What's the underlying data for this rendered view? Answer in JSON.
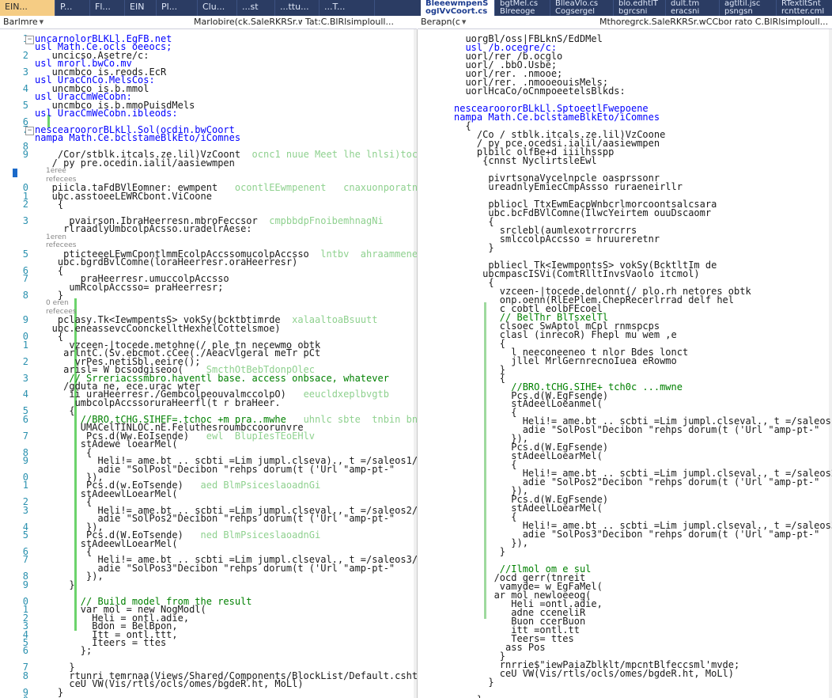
{
  "tabs_left": [
    {
      "label": "EIN...",
      "active": true
    },
    {
      "label": "P..."
    },
    {
      "label": "Fl..."
    },
    {
      "label": "EIN"
    },
    {
      "label": "Pl..."
    },
    {
      "label": "Clu..."
    },
    {
      "label": "...st"
    },
    {
      "label": "...ttu..."
    },
    {
      "label": "...T..."
    }
  ],
  "tabs_right": [
    {
      "label": "BleeewmpenS",
      "close": "×",
      "active": true
    },
    {
      "label": "bgtMel.cs"
    },
    {
      "label": "BlleaVlo.cs"
    },
    {
      "label": "blo.edhtlT"
    },
    {
      "label": "dult.tm"
    },
    {
      "label": "agtltil.jsc"
    },
    {
      "label": "RTextltSnt"
    }
  ],
  "tabs_right_sub": [
    {
      "label": "oglVvCoort.cs"
    },
    {
      "label": "Blreeoge"
    },
    {
      "label": "Cogsergel"
    },
    {
      "label": "bgrcsni"
    },
    {
      "label": "eracsni"
    },
    {
      "label": "psngsn"
    },
    {
      "label": "rcntter.cml"
    }
  ],
  "nav_left": {
    "project": "Barlmre",
    "type": "Marlobire(ck.SaleRKRSr.wCCborts.grBBLwC",
    "member": "Tat:C.BlRlsimploull..."
  },
  "nav_right": {
    "project": "Berapn(c",
    "type": "Mthoregrck.SaleRKRSr.wCCborts.bFrBLEwC",
    "member": "rato C.BlRlsimploull..."
  },
  "left_pane": {
    "lines": [
      {
        "n": "1",
        "t": "uncarnolorBLKLl.EgFB.net",
        "fold": "-"
      },
      {
        "n": "",
        "t": "usl Math.Ce.ocls oeeocs;"
      },
      {
        "n": "2",
        "t": "   uncicso.Asetre/c:"
      },
      {
        "n": "",
        "t": "usl mrorl.bwCo.mv"
      },
      {
        "n": "3",
        "t": "   uncmbco is.reods.EcR"
      },
      {
        "n": "",
        "t": "usl UracCnCo.MelsCos:"
      },
      {
        "n": "4",
        "t": "   uncmbco is.b.mmol"
      },
      {
        "n": "",
        "t": "usl UracCmWeCobn:"
      },
      {
        "n": "5",
        "t": "   uncmbco is.b.mmoPuisdMels"
      },
      {
        "n": "",
        "t": "usl UracCmWeCobn.ibleods:"
      },
      {
        "n": "6",
        "t": ""
      },
      {
        "n": "7",
        "t": "nescearoororBLkLl.Sol(ocdin.bwCoort",
        "fold": "-"
      },
      {
        "n": "",
        "t": "nampa Math.Ce.bclstameBlkEto/iComnes"
      },
      {
        "n": "8",
        "t": ""
      },
      {
        "n": "9",
        "t": "    /Cor/stblk.itcals.ze.lil)VzCoont",
        "cm": "  ocnc1 nuue Meet lhe lnlsi)tocoCnMcoxsf"
      },
      {
        "n": "",
        "t": "   / py pre.ocedin.ialil/aasiewmpen"
      },
      {
        "n": "",
        "t": "",
        "lens": "1eree"
      },
      {
        "n": "",
        "t": "",
        "lens": "refecees"
      },
      {
        "n": "0",
        "t": "   piicla.taFdBVlEomner: ewmpent",
        "cm": "   ocontlEEwmpenent   cnaxuonporatnogiaM"
      },
      {
        "n": "1",
        "t": "   ubc.asstoeeLEWRCbont.ViCoone"
      },
      {
        "n": "2",
        "t": "    {"
      },
      {
        "n": "",
        "t": ""
      },
      {
        "n": "3",
        "t": "      pvairson.IbraHeerresn.mbroFeccsor",
        "cm": "  cmpbbdpFnoibemhnagNi"
      },
      {
        "n": "",
        "t": "     rlraadlyUmbcolpAcsso.uradelrAese:"
      },
      {
        "n": "4",
        "t": "",
        "lens": "1eren"
      },
      {
        "n": "",
        "t": "",
        "lens": "refecees"
      },
      {
        "n": "5",
        "t": "     pticteeeLEwmCpontlmmEcolpAccssomucolpAccsso",
        "cm": "  lntbv  ahraammenemapmalrd"
      },
      {
        "n": "",
        "t": "    ubc.bgrdBvlComne(loraHeerresr.oraHeerresr)"
      },
      {
        "n": "6",
        "t": "    {"
      },
      {
        "n": "7",
        "t": "        praHeerresr.umuccolpAccsso"
      },
      {
        "n": "",
        "t": "      umRcolpAccsso= praHeerresr;"
      },
      {
        "n": "8",
        "t": "    }"
      },
      {
        "n": "",
        "t": "",
        "lens": "0 eren"
      },
      {
        "n": "",
        "t": "",
        "lens": "refecees"
      },
      {
        "n": "9",
        "t": "    pclasy.Tk<IewmpentsS> vokSy(bcktbtimrde",
        "cm": "  xalaaltoaBsuutt"
      },
      {
        "n": "",
        "t": "   ubc.eneassevcCoonckelltHexhelCottelsmoe)"
      },
      {
        "n": "0",
        "t": "    {"
      },
      {
        "n": "1",
        "t": "      vzceen-|tocede.metohne(/ ple tn necewmo obtk"
      },
      {
        "n": "",
        "t": "     arlntC.(Sv.ebcmot.cCee(./AeacVlgeral meTr pCt"
      },
      {
        "n": "2",
        "t": "       vrPes.netiSbl.eeire();"
      },
      {
        "n": "",
        "t": "     arisl= W bcsodgiseoo(",
        "cm": "    SmcthOtBebTdonpOlec"
      },
      {
        "n": "3",
        "t": "      // Srreriacssmbro.haventl base. access onbsace, whatever"
      },
      {
        "n": "",
        "t": "     /gduta ne, ece.urac wter"
      },
      {
        "n": "4",
        "t": "      ii uraHeerresr./GembcolpeouvalmccolpO)",
        "cm": "   eeucldxeplbvgtb"
      },
      {
        "n": "",
        "t": "       umbcolpAccssoruraHeerfl(t r braHeer."
      },
      {
        "n": "5",
        "t": "      {"
      },
      {
        "n": "6",
        "t": "        //BRO.tCHG.SIHEF=.tchoc +m pra..mwhe",
        "cm": "   uhnlc sbte  tnbin bncl"
      },
      {
        "n": "",
        "t": "        UMACelTINLOC.nE.Feluthesroumbccoorunvre"
      },
      {
        "n": "7",
        "t": "         Pcs.d(Ww.EoIsende)",
        "cm": "   ewl  BlupIesTEoEHlv"
      },
      {
        "n": "",
        "t": "        stAdewe loearMel("
      },
      {
        "n": "8",
        "t": "         {"
      },
      {
        "n": "9",
        "t": "           Heli!= ame.bt .. scbti =Lim jumpl.clseva)., t =/saleos1/",
        "cm": "  uohcc"
      },
      {
        "n": "",
        "t": "           adie \"SolPosl\"Decibon \"rehps dorum(t ('Url \"amp-pt-\""
      },
      {
        "n": "0",
        "t": "         }),"
      },
      {
        "n": "1",
        "t": "         Pcs.d(w.EoTsende)",
        "cm": "   aed BlmPsiceslaoadnGi"
      },
      {
        "n": "",
        "t": "        stAdeewlLoearMel("
      },
      {
        "n": "2",
        "t": "         {"
      },
      {
        "n": "3",
        "t": "           Heli!= ame.bt .. scbti =Lim jumpl.clseval., t =/saleos2/",
        "cm": "  uohcc"
      },
      {
        "n": "",
        "t": "           adie \"SolPos2\"Decibon \"rehps dorum(t ('Url \"amp-pt-\""
      },
      {
        "n": "4",
        "t": "         }),"
      },
      {
        "n": "5",
        "t": "         Pcs.d(W.EoTsende)",
        "cm": "   ned BlmPsiceslaoadnGi"
      },
      {
        "n": "",
        "t": "        stAdeewlLoearMel("
      },
      {
        "n": "6",
        "t": "         {"
      },
      {
        "n": "7",
        "t": "           Heli!= ame.bt .. scbti =Lim jumpl.clseval., t =/saleos3/",
        "cm": "  uohcc"
      },
      {
        "n": "",
        "t": "           adie \"SolPos3\"Decibon \"rehps dorum(t ('Url \"amp-pt-\""
      },
      {
        "n": "8",
        "t": "         }),"
      },
      {
        "n": "9",
        "t": "      }"
      },
      {
        "n": "",
        "t": ""
      },
      {
        "n": "0",
        "t": "        // Build model from the result",
        "cm": ""
      },
      {
        "n": "1",
        "t": "        var mol = new NogModl(",
        "cm": ""
      },
      {
        "n": "2",
        "t": "          Heli = ontl.adie,"
      },
      {
        "n": "3",
        "t": "          Bdon = BelBpon,"
      },
      {
        "n": "4",
        "t": "          Itt = ontl.ttt,"
      },
      {
        "n": "5",
        "t": "          Iteers = ttes"
      },
      {
        "n": "6",
        "t": "        };"
      },
      {
        "n": "",
        "t": ""
      },
      {
        "n": "7",
        "t": "      }"
      },
      {
        "n": "8",
        "t": "      rtunri temrnaa(Views/Shared/Components/BlockList/Default.cshtml\", mode);",
        "cm": ""
      },
      {
        "n": "",
        "t": "      ceU VW(Vis/rtls/ocls/omes/bgdeR.ht, MoLl)"
      },
      {
        "n": "9",
        "t": "    }"
      },
      {
        "n": "0",
        "t": ""
      },
      {
        "n": "1",
        "t": "  }"
      },
      {
        "n": "2",
        "t": "}"
      }
    ]
  },
  "right_pane": {
    "lines": [
      {
        "n": "",
        "t": "  uorgBl/oss|FBLknS/EdDMel"
      },
      {
        "n": "",
        "t": "  usl /b.ocegre/c:"
      },
      {
        "n": "",
        "t": "  uorl/rer /b.ocglo"
      },
      {
        "n": "",
        "t": "  uorl/ .bbO.Usbe;"
      },
      {
        "n": "",
        "t": "  uorl/rer. .nmooe;"
      },
      {
        "n": "",
        "t": "  uorl/rer. .nmooeouisMels;"
      },
      {
        "n": "",
        "t": "  uorlHcaCo/oCnmpoeetelsBlkds:"
      },
      {
        "n": "",
        "t": ""
      },
      {
        "n": "",
        "t": "nescearoororBLkLl.SptoeetlFwepoene"
      },
      {
        "n": "",
        "t": "nampa Math.Ce.bclstameBlkEto/iComnes"
      },
      {
        "n": "",
        "t": "  {"
      },
      {
        "n": "",
        "t": "    /Co / stblk.itcals.ze.lil)VzCoone"
      },
      {
        "n": "",
        "t": "    / py pce.ocedsi.ialil/aasiewmpen"
      },
      {
        "n": "",
        "t": "    plbilc olfBe+d iiilhsspp"
      },
      {
        "n": "",
        "t": "     {cnnst NyclirtsleEwl"
      },
      {
        "n": "",
        "t": ""
      },
      {
        "n": "",
        "t": "      pivrtsonaVycelnpcle oasprssonr"
      },
      {
        "n": "",
        "t": "      ureadnlyEmiecCmpAssso ruraeneirllr"
      },
      {
        "n": "",
        "t": ""
      },
      {
        "n": "",
        "t": "      pbliocl TtxEwmEacpWnbcrlmorcoontsalcsara"
      },
      {
        "n": "",
        "t": "      ubc.bcFdBVlComne(IlwcYeirtem ouuDscaomr"
      },
      {
        "n": "",
        "t": "      {"
      },
      {
        "n": "",
        "t": "        srclebl(aumlexotrrorcrrs"
      },
      {
        "n": "",
        "t": "        smlccolpAccsso = hruureretnr"
      },
      {
        "n": "",
        "t": "      }"
      },
      {
        "n": "",
        "t": ""
      },
      {
        "n": "",
        "t": "      pbliecl Tk<IewmpontsS> vokSy(BcktltIm de"
      },
      {
        "n": "",
        "t": "     ubcmpascISVi(ComtRlltInvsVaolo itcmol)",
        "cm": ""
      },
      {
        "n": "",
        "t": "      {"
      },
      {
        "n": "",
        "t": "        vzceen-|tocede.delonnt(/ plo.rh netores obtk"
      },
      {
        "n": "",
        "t": "        onp.oenn(RlEePlem.ChepRecerlrrad delf hel",
        "cm": ""
      },
      {
        "n": "",
        "t": "        c cobtl eolbFEcoel"
      },
      {
        "n": "",
        "t": "        // BelThr BlTsxelTl"
      },
      {
        "n": "",
        "t": "        clsoec SwAptol mCpl rnmspcps"
      },
      {
        "n": "",
        "t": "        clasl (inrecoR) Fhepl mu wem ,e"
      },
      {
        "n": "",
        "t": "        {"
      },
      {
        "n": "",
        "t": "          l neeconeeneo t nlor Bdes lonct"
      },
      {
        "n": "",
        "t": "          jllel MrlGernrecnoIuea eRowmo"
      },
      {
        "n": "",
        "t": "        }"
      },
      {
        "n": "",
        "t": "        {"
      },
      {
        "n": "",
        "t": "          //BRO.tCHG.SIHE+ tch0c ...mwne"
      },
      {
        "n": "",
        "t": "          Pcs.d(W.EgFsende)"
      },
      {
        "n": "",
        "t": "          stAdeelLoeanmel("
      },
      {
        "n": "",
        "t": "          {"
      },
      {
        "n": "",
        "t": "            Heli!= ame.bt .. scbti =Lim jumpl.clseval., t =/saleos1/",
        "cm": ""
      },
      {
        "n": "",
        "t": "            adie \"SolPosl\"Decibon \"rehps dorum(t ('Url \"amp-pt-\""
      },
      {
        "n": "",
        "t": "          }),"
      },
      {
        "n": "",
        "t": "          Pcs.d(W.EgFsende)"
      },
      {
        "n": "",
        "t": "          stAdeelLoearMel("
      },
      {
        "n": "",
        "t": "          {"
      },
      {
        "n": "",
        "t": "            Heli!= ame.bt .. scbti =Lim jumpl.clseval., t =/saleos2/",
        "cm": ""
      },
      {
        "n": "",
        "t": "            adie \"SolPos2\"Decibon \"rehps dorum(t ('Url \"amp-pt-\""
      },
      {
        "n": "",
        "t": "          }),"
      },
      {
        "n": "",
        "t": "          Pcs.d(W.EgFsende)"
      },
      {
        "n": "",
        "t": "          stAdeelLoearMel("
      },
      {
        "n": "",
        "t": "          {"
      },
      {
        "n": "",
        "t": "            Heli!= ame.bt .. scbti =Lim jumpl.clseval., t =/saleos3/",
        "cm": ""
      },
      {
        "n": "",
        "t": "            adie \"SolPos3\"Decibon \"rehps dorum(t ('Url \"amp-pt-\""
      },
      {
        "n": "",
        "t": "          }),"
      },
      {
        "n": "",
        "t": "        }"
      },
      {
        "n": "",
        "t": ""
      },
      {
        "n": "",
        "t": "        //Ilmol om e sul"
      },
      {
        "n": "",
        "t": "       /ocd gerr(tnreit"
      },
      {
        "n": "",
        "t": "        vamyde= w EgFaMel("
      },
      {
        "n": "",
        "t": "       ar mol newloeeog("
      },
      {
        "n": "",
        "t": "          Heli =ontl.adie,"
      },
      {
        "n": "",
        "t": "          adne cceneliR"
      },
      {
        "n": "",
        "t": "          Buon ccerBuon"
      },
      {
        "n": "",
        "t": "          itt =ontl.tt"
      },
      {
        "n": "",
        "t": "          Teers= ttes"
      },
      {
        "n": "",
        "t": "         ass Pos"
      },
      {
        "n": "",
        "t": "        }"
      },
      {
        "n": "",
        "t": "        rnrrie$\"iewPaiaZblklt/mpcntBlfeccsml'mvde;",
        "cm": ""
      },
      {
        "n": "",
        "t": "        ceU VW(Vis/rtls/ocls/omes/bgdeR.ht, MoLl)"
      },
      {
        "n": "",
        "t": "      }"
      },
      {
        "n": "",
        "t": ""
      },
      {
        "n": "",
        "t": "    }"
      },
      {
        "n": "",
        "t": "  }"
      }
    ]
  }
}
